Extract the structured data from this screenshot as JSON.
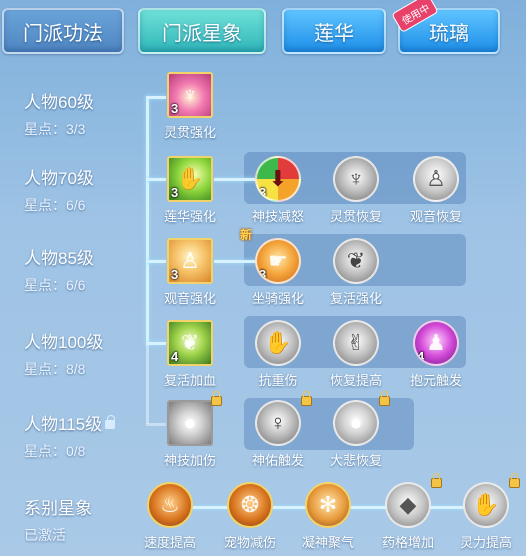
{
  "tabs": [
    {
      "label": "门派功法"
    },
    {
      "label": "门派星象"
    },
    {
      "label": "莲华"
    },
    {
      "label": "琉璃",
      "badge": "使用中"
    }
  ],
  "levels": [
    {
      "name": "人物60级",
      "points": "星点：3/3"
    },
    {
      "name": "人物70级",
      "points": "星点：6/6"
    },
    {
      "name": "人物85级",
      "points": "星点：6/6"
    },
    {
      "name": "人物100级",
      "points": "星点：8/8"
    },
    {
      "name": "人物115级",
      "points": "星点：0/8"
    },
    {
      "name": "系别星象",
      "points": "已激活"
    }
  ],
  "skills": {
    "r1": [
      {
        "label": "灵贯强化",
        "count": "3",
        "icon": "lingguan-icon"
      }
    ],
    "r2": [
      {
        "label": "莲华强化",
        "count": "3",
        "icon": "lotus-hand-icon"
      },
      {
        "label": "神技减怒",
        "count": "3",
        "icon": "rage-reduce-icon"
      },
      {
        "label": "灵贯恢复",
        "icon": "lingguan-recover-icon"
      },
      {
        "label": "观音恢复",
        "icon": "guanyin-recover-icon"
      }
    ],
    "r3": [
      {
        "label": "观音强化",
        "count": "3",
        "icon": "guanyin-icon"
      },
      {
        "label": "坐骑强化",
        "count": "3",
        "icon": "mount-icon",
        "tag": "新"
      },
      {
        "label": "复活强化",
        "icon": "revive-icon"
      }
    ],
    "r4": [
      {
        "label": "复活加血",
        "count": "4",
        "icon": "bamboo-icon"
      },
      {
        "label": "抗重伤",
        "icon": "resist-icon"
      },
      {
        "label": "恢复提高",
        "icon": "recover-up-icon"
      },
      {
        "label": "抱元触发",
        "count": "4",
        "icon": "meditate-icon"
      }
    ],
    "r5": [
      {
        "label": "神技加伤",
        "icon": "pearl-icon"
      },
      {
        "label": "神佑触发",
        "icon": "blessing-icon"
      },
      {
        "label": "大悲恢复",
        "icon": "pearl-recover-icon"
      }
    ],
    "r6": [
      {
        "label": "速度提高",
        "icon": "speed-icon"
      },
      {
        "label": "宠物减伤",
        "icon": "pet-icon"
      },
      {
        "label": "凝神聚气",
        "icon": "focus-icon"
      },
      {
        "label": "药格增加",
        "icon": "potion-icon"
      },
      {
        "label": "灵力提高",
        "icon": "spirit-icon"
      }
    ]
  },
  "colors": {
    "accent": "#2fb7b9",
    "lock": "#f3c445"
  }
}
